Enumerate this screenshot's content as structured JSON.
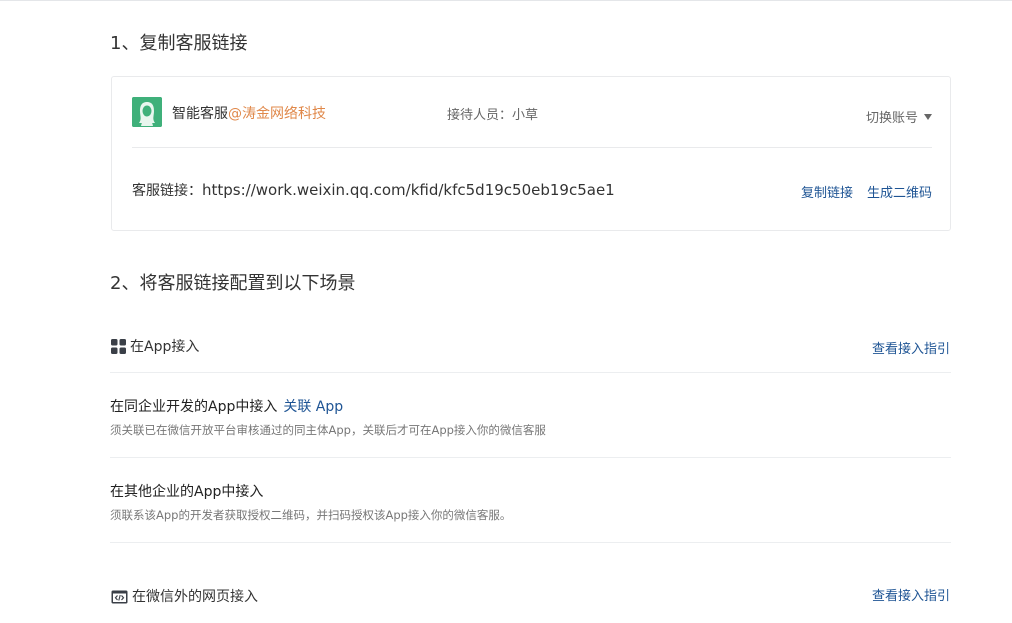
{
  "section1": {
    "title": "1、复制客服链接"
  },
  "card": {
    "agent_name": "智能客服",
    "agent_corp": "@涛金网络科技",
    "receptionist": "接待人员：小草",
    "switch_account": "切换账号",
    "link_label": "客服链接：",
    "link_url": "https://work.weixin.qq.com/kfid/kfc5d19c50eb19c5ae1",
    "copy_link": "复制链接",
    "gen_qrcode": "生成二维码"
  },
  "section2": {
    "title": "2、将客服链接配置到以下场景",
    "app_scene": {
      "title": "在App接入",
      "guide": "查看接入指引",
      "items": [
        {
          "title": "在同企业开发的App中接入",
          "link": "关联 App",
          "desc": "须关联已在微信开放平台审核通过的同主体App，关联后才可在App接入你的微信客服"
        },
        {
          "title": "在其他企业的App中接入",
          "desc": "须联系该App的开发者获取授权二维码，并扫码授权该App接入你的微信客服。"
        }
      ]
    },
    "web_scene": {
      "title": "在微信外的网页接入",
      "guide": "查看接入指引"
    }
  },
  "colors": {
    "link_blue": "#1e5494",
    "corp_orange": "#e0884a",
    "avatar_green": "#3fb07a"
  }
}
